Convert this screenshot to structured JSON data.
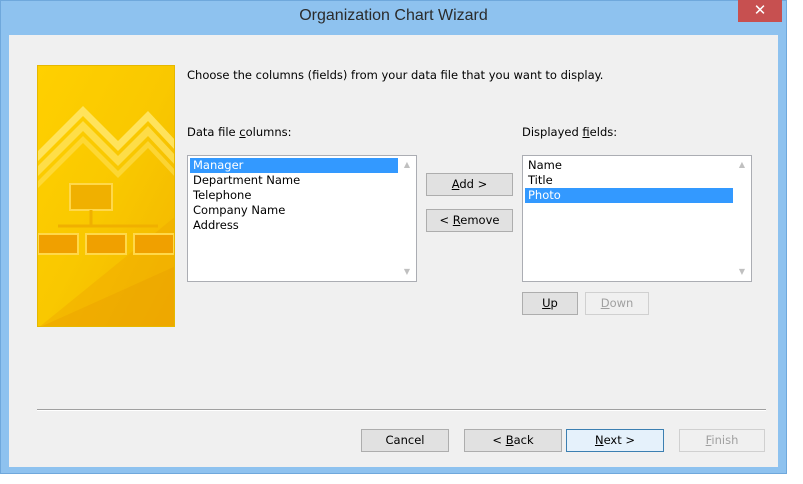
{
  "window": {
    "title": "Organization Chart Wizard",
    "close_label": "✕"
  },
  "instruction": "Choose the columns (fields) from your data file that you want to display.",
  "data_file_columns": {
    "label_before": "Data file ",
    "label_accel": "c",
    "label_after": "olumns:",
    "items": [
      "Manager",
      "Department Name",
      "Telephone",
      "Company Name",
      "Address"
    ],
    "selected": "Manager"
  },
  "displayed_fields": {
    "label_before": "Displayed ",
    "label_accel": "f",
    "label_after": "ields:",
    "items": [
      "Name",
      "Title",
      "Photo"
    ],
    "selected": "Photo"
  },
  "buttons": {
    "add_accel": "A",
    "add_rest": "dd >",
    "remove_prefix": "< ",
    "remove_accel": "R",
    "remove_rest": "emove",
    "up_accel": "U",
    "up_rest": "p",
    "down_accel": "D",
    "down_rest": "own",
    "cancel": "Cancel",
    "back_prefix": "< ",
    "back_accel": "B",
    "back_rest": "ack",
    "next_accel": "N",
    "next_rest": "ext >",
    "finish_accel": "F",
    "finish_rest": "inish"
  },
  "icons": {
    "close": "close-icon",
    "scroll_up": "chevron-up-icon",
    "scroll_down": "chevron-down-icon",
    "banner": "org-chart-banner"
  },
  "colors": {
    "titlebar": "#8ec2ef",
    "close": "#c75050",
    "selection": "#3399ff",
    "banner": "#f5c400"
  }
}
